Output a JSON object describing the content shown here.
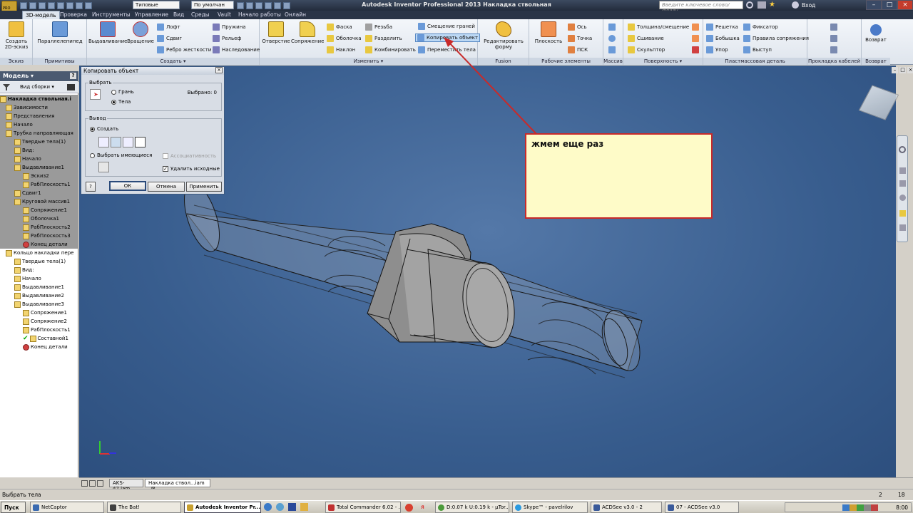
{
  "app": {
    "title": "Autodesk Inventor Professional 2013    Накладка ствольная",
    "search_placeholder": "Введите ключевое слово/фразу",
    "sign_in": "Вход",
    "style_dropdown": "Типовые",
    "color_dropdown": "По умолчан",
    "pro_badge": "PRO"
  },
  "menu_tabs": [
    "3D-модель",
    "Проверка",
    "Инструменты",
    "Управление",
    "Вид",
    "Среды",
    "Vault",
    "Начало работы",
    "Онлайн"
  ],
  "ribbon": {
    "sketch": {
      "label": "Эскиз",
      "create_2d": "Создать 2D-эскиз"
    },
    "primitives": {
      "label": "Примитивы",
      "box": "Параллелепипед"
    },
    "create": {
      "label": "Создать ▾",
      "extrude": "Выдавливание",
      "revolve": "Вращение",
      "small": [
        "Лофт",
        "Сдвиг",
        "Ребро жесткости",
        "Пружина",
        "Рельеф",
        "Наследование"
      ]
    },
    "modify": {
      "label": "Изменить ▾",
      "hole": "Отверстие",
      "fillet": "Сопряжение",
      "small": [
        "Фаска",
        "Оболочка",
        "Наклон",
        "Резьба",
        "Разделить",
        "Комбинировать",
        "Смещение граней",
        "Копировать объект",
        "Переместить тела"
      ]
    },
    "fusion": {
      "label": "Fusion",
      "edit_form": "Редактировать форму"
    },
    "work_features": {
      "label": "Рабочие элементы",
      "plane": "Плоскость",
      "small": [
        "Ось",
        "Точка",
        "ПСК"
      ]
    },
    "pattern": {
      "label": "Массив"
    },
    "surface": {
      "label": "Поверхность ▾",
      "small": [
        "Толщина/смещение",
        "Сшивание",
        "Скульптор"
      ]
    },
    "plastic_part": {
      "label": "Пластмассовая деталь",
      "small": [
        "Решетка",
        "Бобышка",
        "Упор",
        "Фиксатор",
        "Правила сопряжения",
        "Выступ"
      ]
    },
    "cable": {
      "label": "Прокладка кабелей"
    },
    "return": {
      "label": "Возврат",
      "button": "Возврат"
    }
  },
  "browser": {
    "title": "Модель ▾",
    "view_label": "Вид сборки",
    "items": [
      "Накладка ствольная.i",
      "Зависимости",
      "Представления",
      "Начало",
      "Трубка направляющая",
      "Твердые тела(1)",
      "Вид:",
      "Начало",
      "Выдавливание1",
      "Эскиз2",
      "РабПлоскость1",
      "Сдвиг1",
      "Круговой массив1",
      "Сопряжение1",
      "Оболочка1",
      "РабПлоскость2",
      "РабПлоскость3",
      "Конец детали",
      "Кольцо накладки пере",
      "Твердые тела(1)",
      "Вид:",
      "Начало",
      "Выдавливание1",
      "Выдавливание2",
      "Выдавливание3",
      "Сопряжение1",
      "Сопряжение2",
      "РабПлоскость1",
      "Составной1",
      "Конец детали"
    ]
  },
  "dialog": {
    "title": "Копировать объект",
    "select_group": "Выбрать",
    "face": "Грань",
    "bodies": "Тела",
    "selected": "Выбрано: 0",
    "output_group": "Вывод",
    "create": "Создать",
    "select_existing": "Выбрать имеющиеся",
    "associative": "Ассоциативность",
    "delete_original": "Удалить исходные",
    "ok": "ОК",
    "cancel": "Отмена",
    "apply": "Применить",
    "help": "?"
  },
  "annotation": {
    "text": "жмем еще раз",
    "color": "#c82a2a"
  },
  "doc_tabs": [
    "AKS-47.iam",
    "Накладка ствол...iam"
  ],
  "status": {
    "left": "Выбрать тела",
    "right1": "2",
    "right2": "18"
  },
  "taskbar": {
    "start": "Пуск",
    "items": [
      "NetCaptor",
      "The Bat!",
      "Autodesk Inventor Pr...",
      "Total Commander 6.02 - ...",
      "D:0.07 k U:0.19 k - µTor...",
      "Skype™ - pavelrilov",
      "ACDSee v3.0 - 2",
      "07 - ACDSee v3.0"
    ],
    "clock": "8:00"
  },
  "colors": {
    "viewport": "#385d8e",
    "titlebar": "#2a3446",
    "highlight": "#bcd8f4"
  }
}
